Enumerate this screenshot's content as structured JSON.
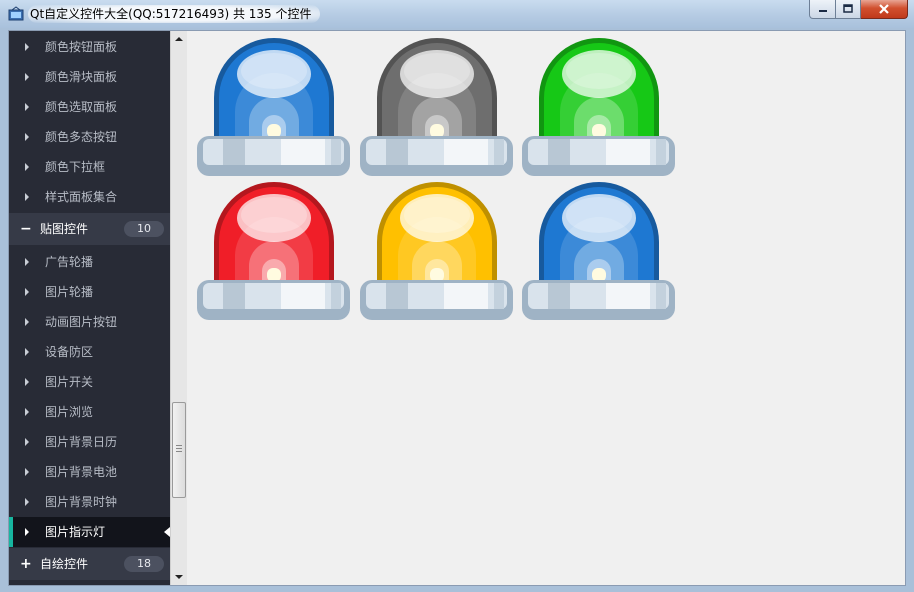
{
  "window": {
    "title": "Qt自定义控件大全(QQ:517216493) 共 135 个控件",
    "icon": "app-icon",
    "buttons": {
      "minimize": "minimize-icon",
      "maximize": "maximize-icon",
      "close": "close-icon"
    }
  },
  "nav": {
    "items_top": [
      {
        "label": "颜色按钮面板"
      },
      {
        "label": "颜色滑块面板"
      },
      {
        "label": "颜色选取面板"
      },
      {
        "label": "颜色多态按钮"
      },
      {
        "label": "颜色下拉框"
      },
      {
        "label": "样式面板集合"
      }
    ],
    "group_image": {
      "sign": "−",
      "label": "贴图控件",
      "count": "10"
    },
    "image_items": [
      {
        "label": "广告轮播"
      },
      {
        "label": "图片轮播"
      },
      {
        "label": "动画图片按钮"
      },
      {
        "label": "设备防区"
      },
      {
        "label": "图片开关"
      },
      {
        "label": "图片浏览"
      },
      {
        "label": "图片背景日历"
      },
      {
        "label": "图片背景电池"
      },
      {
        "label": "图片背景时钟"
      },
      {
        "label": "图片指示灯",
        "selected": true
      }
    ],
    "group_paint": {
      "sign": "+",
      "label": "自绘控件",
      "count": "18"
    },
    "colors": {
      "background": "#282b36",
      "group": "#363a47",
      "selected": "#12141b",
      "accent": "#17b6a0"
    }
  },
  "indicator_lights": [
    {
      "color_name": "blue",
      "color": "#1e78d2"
    },
    {
      "color_name": "gray",
      "color": "#6e6e6e"
    },
    {
      "color_name": "green",
      "color": "#16c816"
    },
    {
      "color_name": "red",
      "color": "#f01e28"
    },
    {
      "color_name": "yellow",
      "color": "#ffc000"
    },
    {
      "color_name": "blue",
      "color": "#1e78d2"
    }
  ]
}
